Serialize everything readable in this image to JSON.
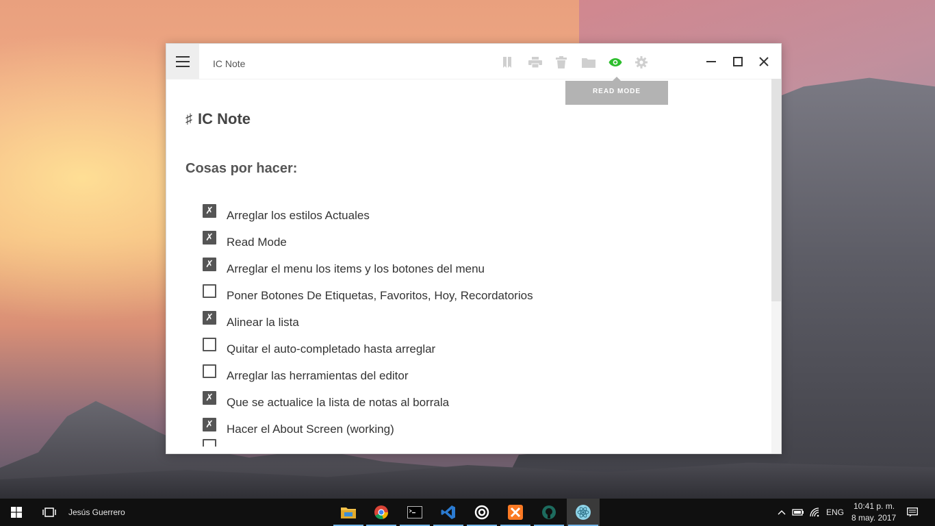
{
  "window": {
    "title": "IC Note",
    "tooltip": "READ MODE",
    "toolbar": [
      {
        "name": "bookmark-icon",
        "color": "#cfcfcf"
      },
      {
        "name": "print-icon",
        "color": "#cfcfcf"
      },
      {
        "name": "trash-icon",
        "color": "#cfcfcf"
      },
      {
        "name": "folder-icon",
        "color": "#cfcfcf"
      },
      {
        "name": "eye-icon",
        "color": "#2dbe2d",
        "active": true
      },
      {
        "name": "gear-icon",
        "color": "#cfcfcf"
      }
    ],
    "controls": [
      "minimize",
      "maximize",
      "close"
    ]
  },
  "document": {
    "heading_symbol": "♯",
    "heading": "IC Note",
    "section_title": "Cosas por hacer:",
    "todos": [
      {
        "label": "Arreglar los estilos Actuales",
        "checked": true
      },
      {
        "label": "Read Mode",
        "checked": true
      },
      {
        "label": "Arreglar el menu los items y los botones del menu",
        "checked": true
      },
      {
        "label": "Poner Botones De Etiquetas, Favoritos, Hoy, Recordatorios",
        "checked": false
      },
      {
        "label": "Alinear la lista",
        "checked": true
      },
      {
        "label": "Quitar el auto-completado hasta arreglar",
        "checked": false
      },
      {
        "label": "Arreglar las herramientas del editor",
        "checked": false
      },
      {
        "label": "Que se actualice la lista de notas al borrala",
        "checked": true
      },
      {
        "label": "Hacer el About Screen (working)",
        "checked": true
      }
    ],
    "check_mark": "✗"
  },
  "taskbar": {
    "user": "Jesús Guerrero",
    "apps": [
      "file-explorer",
      "chrome",
      "terminal",
      "visual-studio-code",
      "app-circle",
      "xampp",
      "github-desktop",
      "ic-note-atom"
    ],
    "language": "ENG",
    "time": "10:41 p. m.",
    "date": "8 may. 2017"
  },
  "colors": {
    "accent_green": "#2dbe2d",
    "checkbox": "#555555",
    "tooltip_bg": "#b3b3b3"
  }
}
